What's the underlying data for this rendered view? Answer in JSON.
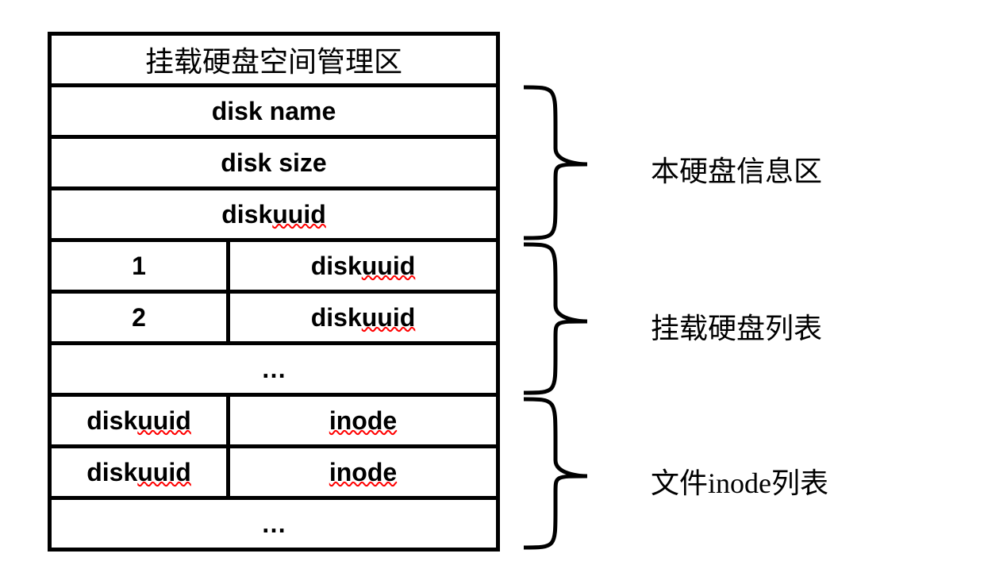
{
  "table": {
    "header": "挂载硬盘空间管理区",
    "info": {
      "row1": "disk name",
      "row2": "disk size",
      "row3_prefix": "disk ",
      "row3_wavy": "uuid"
    },
    "diskList": {
      "row1_left": "1",
      "row1_right_prefix": "disk ",
      "row1_right_wavy": "uuid",
      "row2_left": "2",
      "row2_right_prefix": "disk ",
      "row2_right_wavy": "uuid",
      "row3": "…"
    },
    "inodeList": {
      "row1_left_prefix": "disk ",
      "row1_left_wavy": "uuid",
      "row1_right": "inode",
      "row2_left_prefix": "disk ",
      "row2_left_wavy": "uuid",
      "row2_right": "inode",
      "row3": "…"
    }
  },
  "labels": {
    "info": "本硬盘信息区",
    "diskList": "挂载硬盘列表",
    "inodeList": "文件inode列表"
  }
}
